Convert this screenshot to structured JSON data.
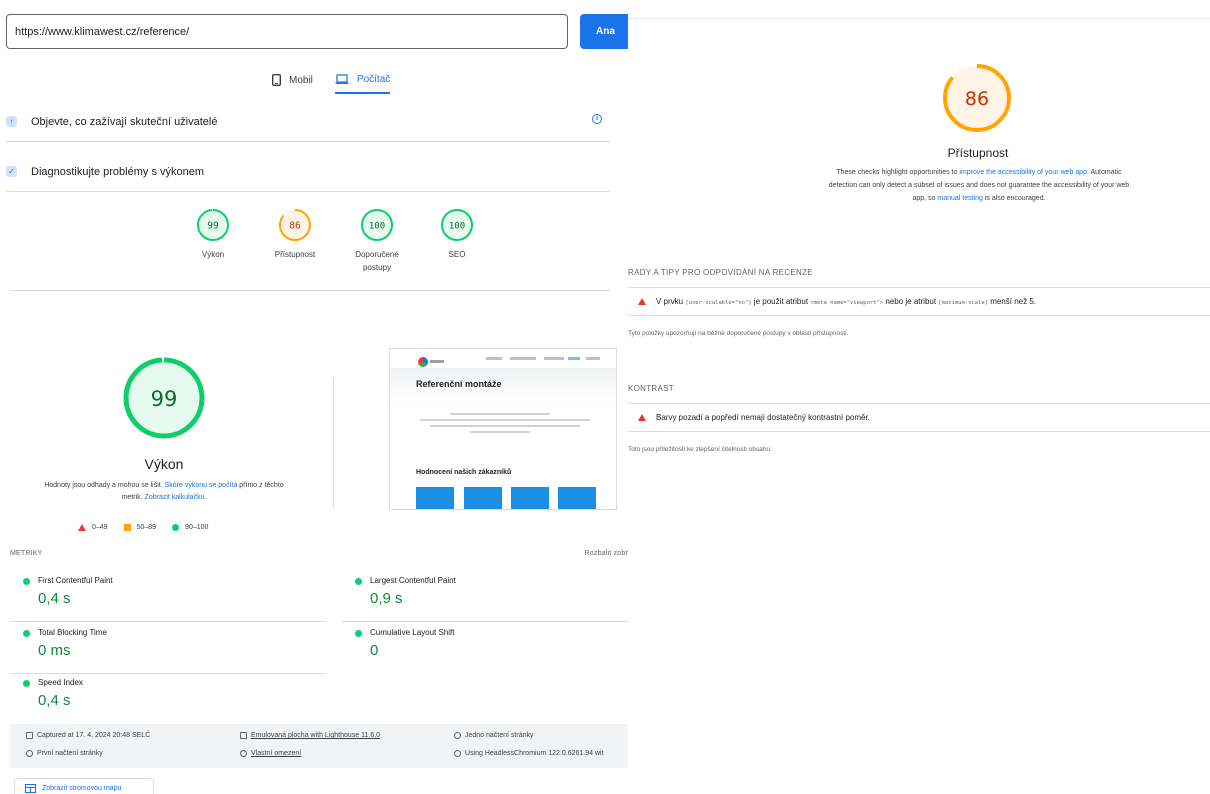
{
  "url_bar": {
    "value": "https://www.klimawest.cz/reference/",
    "analyze_label": "Ana"
  },
  "device_tabs": [
    {
      "label": "Mobil",
      "active": false
    },
    {
      "label": "Počítač",
      "active": true
    }
  ],
  "sections": {
    "field": "Objevte, co zažívají skuteční uživatelé",
    "diagnose": "Diagnostikujte problémy s výkonem"
  },
  "scores": [
    {
      "value": 99,
      "label": "Výkon",
      "status": "pass"
    },
    {
      "value": 86,
      "label": "Přístupnost",
      "status": "average"
    },
    {
      "value": 100,
      "label": "Doporučené postupy",
      "status": "pass"
    },
    {
      "value": 100,
      "label": "SEO",
      "status": "pass"
    }
  ],
  "performance": {
    "score": 99,
    "title": "Výkon",
    "desc_1": "Hodnoty jsou odhady a mohou se lišit. ",
    "desc_link_1": "Skóre výkonu se počítá",
    "desc_2": " přímo z těchto metrik. ",
    "desc_link_2": "Zobrazit kalkulačku."
  },
  "legend": {
    "fail": "0–49",
    "average": "50–89",
    "pass": "90–100"
  },
  "screenshot_preview": {
    "title": "Referenční montáže",
    "subtitle": "Hodnocení našich zákazníků"
  },
  "metrics": {
    "header": "METRIKY",
    "expand": "Rozbalit zobr",
    "items": [
      {
        "name": "First Contentful Paint",
        "value": "0,4 s"
      },
      {
        "name": "Largest Contentful Paint",
        "value": "0,9 s"
      },
      {
        "name": "Total Blocking Time",
        "value": "0 ms"
      },
      {
        "name": "Cumulative Layout Shift",
        "value": "0"
      },
      {
        "name": "Speed Index",
        "value": "0,4 s"
      }
    ]
  },
  "footer": {
    "captured": "Captured at 17. 4. 2024 20:48 SELČ",
    "load": "První načtení stránky",
    "emulated": "Emulovaná plocha with Lighthouse 11.6.0",
    "throttling": "Vlastní omezení",
    "single": "Jedno načtení stránky",
    "browser": "Using HeadlessChromium 122.0.6261.94 wit"
  },
  "treemap_button": "Zobrazit stromovou mapu",
  "accessibility": {
    "score": 86,
    "title": "Přístupnost",
    "desc_1": "These checks highlight opportunities to ",
    "desc_link_1": "improve the accessibility of your web app",
    "desc_2": ". Automatic detection can only detect a subset of issues and does not guarantee the accessibility of your web app, so ",
    "desc_link_2": "manual testing",
    "desc_3": " is also encouraged."
  },
  "groups": [
    {
      "title": "RADY A TIPY PRO ODPOVÍDÁNÍ NA RECENZE",
      "audit": {
        "p1": "V prvku ",
        "c1": "[user-scalable=\"no\"]",
        "p2": " je použit atribut ",
        "c2": "<meta name=\"viewport\">",
        "p3": " nebo je atribut ",
        "c3": "[maximum-scale]",
        "p4": " menší než 5."
      },
      "note": "Tyto položky upozorňují na běžné doporučené postupy v oblasti přístupnosti."
    },
    {
      "title": "KONTRAST",
      "audit_text": "Barvy pozadí a popředí nemají dostatečný kontrastní poměr.",
      "note": "Toto jsou příležitosti ke zlepšení čitelnosti obsahu."
    }
  ],
  "colors": {
    "pass": "#0cce6b",
    "pass_text": "#0c6b2e",
    "pass_bg": "#e6f9ef",
    "average": "#ffa400",
    "average_text": "#c33300",
    "average_bg": "#fff4e5",
    "fail": "#ea3829",
    "accent": "#1a73e8"
  }
}
